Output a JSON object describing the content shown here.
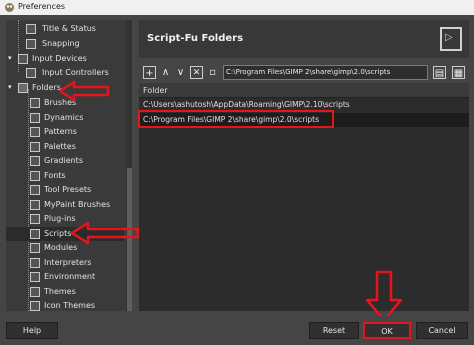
{
  "window": {
    "title": "Preferences"
  },
  "sidebar": {
    "items": [
      {
        "label": "Title & Status"
      },
      {
        "label": "Snapping"
      },
      {
        "label": "Input Devices"
      },
      {
        "label": "Input Controllers"
      },
      {
        "label": "Folders"
      },
      {
        "label": "Brushes"
      },
      {
        "label": "Dynamics"
      },
      {
        "label": "Patterns"
      },
      {
        "label": "Palettes"
      },
      {
        "label": "Gradients"
      },
      {
        "label": "Fonts"
      },
      {
        "label": "Tool Presets"
      },
      {
        "label": "MyPaint Brushes"
      },
      {
        "label": "Plug-ins"
      },
      {
        "label": "Scripts"
      },
      {
        "label": "Modules"
      },
      {
        "label": "Interpreters"
      },
      {
        "label": "Environment"
      },
      {
        "label": "Themes"
      },
      {
        "label": "Icon Themes"
      }
    ],
    "selected": "Scripts"
  },
  "panel": {
    "title": "Script-Fu Folders",
    "path_value": "C:\\Program Files\\GIMP 2\\share\\gimp\\2.0\\scripts",
    "list_header": "Folder",
    "folders": [
      "C:\\Users\\ashutosh\\AppData\\Roaming\\GIMP\\2.10\\scripts",
      "C:\\Program Files\\GIMP 2\\share\\gimp\\2.0\\scripts"
    ]
  },
  "buttons": {
    "help": "Help",
    "reset": "Reset",
    "ok": "OK",
    "cancel": "Cancel"
  },
  "colors": {
    "annotation": "#e8141c",
    "background": "#454545"
  }
}
